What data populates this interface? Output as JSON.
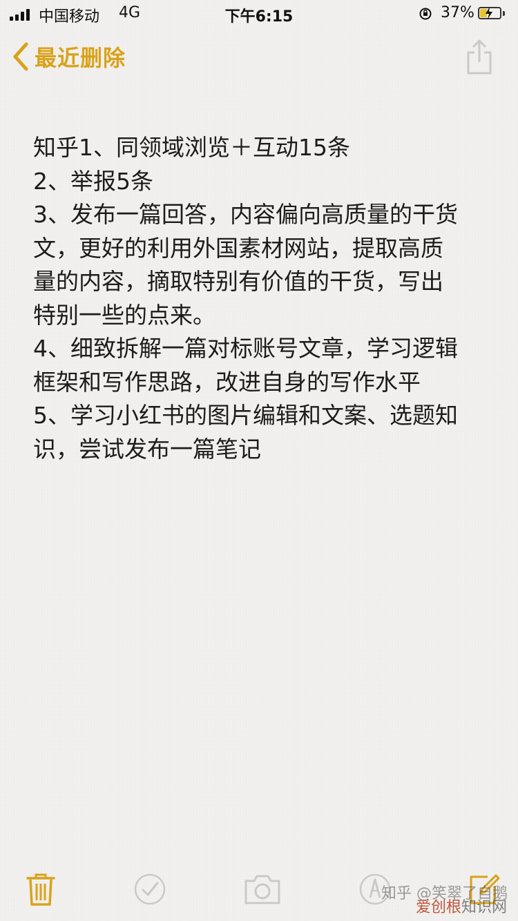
{
  "status_bar": {
    "carrier": "中国移动",
    "network": "4G",
    "time": "下午6:15",
    "battery_percent": "37%",
    "battery_level": 0.37
  },
  "nav": {
    "back_label": "最近删除",
    "back_icon": "chevron-left-icon",
    "share_icon": "share-icon"
  },
  "note": {
    "lines": [
      "知乎1、同领域浏览＋互动15条",
      "2、举报5条",
      "3、发布一篇回答，内容偏向高质量的干货",
      "文，更好的利用外国素材网站，提取高质",
      "量的内容，摘取特别有价值的干货，写出",
      "特别一些的点来。",
      "4、细致拆解一篇对标账号文章，学习逻辑",
      "框架和写作思路，改进自身的写作水平",
      "5、学习小红书的图片编辑和文案、选题知",
      "识，尝试发布一篇笔记"
    ]
  },
  "toolbar": {
    "icons": [
      "trash-icon",
      "checklist-icon",
      "camera-icon",
      "markup-icon",
      "compose-icon"
    ]
  },
  "watermark": {
    "line1": "知乎 @笑翠了自鹅",
    "line2_a": "爱创根",
    "line2_b": "知识网"
  },
  "colors": {
    "accent": "#d9a21a",
    "background": "#f2f1ef",
    "text": "#1c1c1c"
  }
}
